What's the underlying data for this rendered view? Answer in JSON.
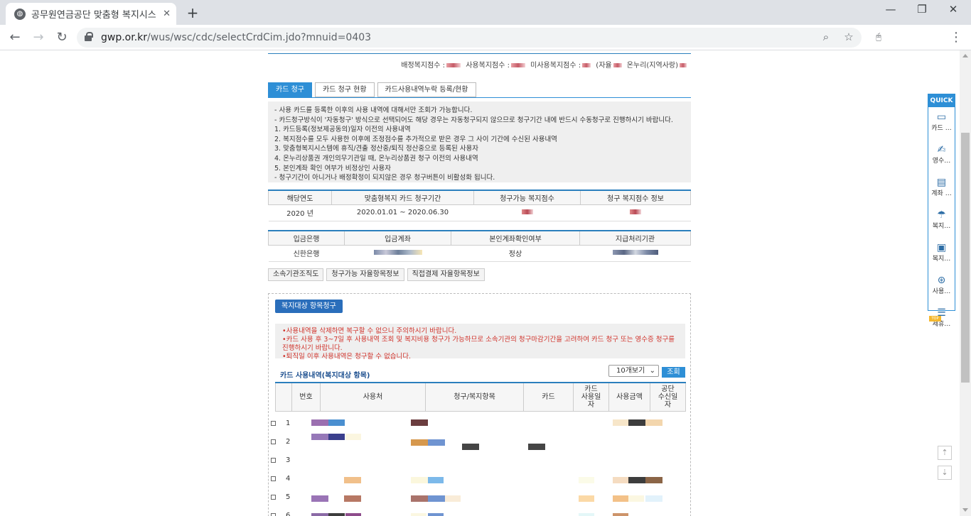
{
  "browser": {
    "tab_title": "공무원연금공단 맞춤형 복지시스",
    "url_host": "gwp.or.kr",
    "url_path": "/wus/wsc/cdc/selectCrdCim.jdo?mnuid=0403"
  },
  "counts": {
    "allocated": "배정복지점수 :",
    "used": "사용복지점수 :",
    "unused": "미사용복지점수 :",
    "self_label": "(자율",
    "onnuri_label": "온누리(지역사랑)"
  },
  "tabs": [
    "카드 청구",
    "카드 청구 현황",
    "카드사용내역누락 등록/현황"
  ],
  "notice_lines": [
    "- 사용 카드를 등록한 이후의 사용 내역에 대해서만 조회가 가능합니다.",
    "- 카드청구방식이 '자동청구' 방식으로 선택되어도 해당 경우는 자동청구되지 않으므로 청구기간 내에 반드시 수동청구로 진행하시기 바랍니다.",
    "1. 카드등록(정보제공동의)일자 이전의 사용내역",
    "2. 복지점수를 모두 사용한 이후에 조정점수를 추가적으로 받은 경우 그 사이 기간에 수신된 사용내역",
    "3. 맞춤형복지시스템에 휴직/견출 정산중/퇴직 정산중으로 등록된 사용자",
    "4. 온누리상품권 개인의무기관일 때, 온누리상품권 청구 이전의 사용내역",
    "5. 본인계좌 확인 여부가 비정상인 사용자",
    "- 청구기간이 아니거나 배정확정이 되지않은 경우 청구버튼이 비활성화 됩니다."
  ],
  "period_table": {
    "headers": [
      "해당연도",
      "맞춤형복지 카드 청구기간",
      "청구가능 복지점수",
      "청구 복지점수 정보"
    ],
    "year": "2020 년",
    "period": "2020.01.01 ~ 2020.06.30"
  },
  "bank_table": {
    "headers": [
      "입금은행",
      "입금계좌",
      "본인계좌확인여부",
      "지급처리기관"
    ],
    "bank": "신한은행",
    "status": "정상"
  },
  "sub_buttons": [
    "소속기관조직도",
    "청구가능 자율항목정보",
    "직접결제 자율항목정보"
  ],
  "claim": {
    "button": "복지대상 항목청구",
    "warnings": [
      "•사용내역을 삭제하면 복구할 수 없으니 주의하시기 바랍니다.",
      "•카드 사용 후 3~7일 후 사용내역 조회 및 복지비용 청구가 가능하므로 소속기관의 청구마감기간을 고려하여 카드 청구 또는 영수증 청구를 진행하시기 바랍니다.",
      "•퇴직일 이후 사용내역은 청구할 수 없습니다."
    ],
    "list_title": "카드 사용내역(복지대상 항목)",
    "page_size": "10개보기",
    "search_label": "조회",
    "headers": [
      "번호",
      "사용처",
      "청구/복지항목",
      "카드",
      "카드\n사용일\n자",
      "사용금액",
      "공단\n수신일\n자"
    ],
    "row_numbers": [
      "1",
      "2",
      "3",
      "4",
      "5",
      "6"
    ]
  },
  "quick_menu": {
    "title": "QUICK",
    "items": [
      "카드 …",
      "영수…",
      "계좌 …",
      "복지…",
      "복지…",
      "사용…",
      "제휴…"
    ],
    "top_badge": "TOP"
  }
}
